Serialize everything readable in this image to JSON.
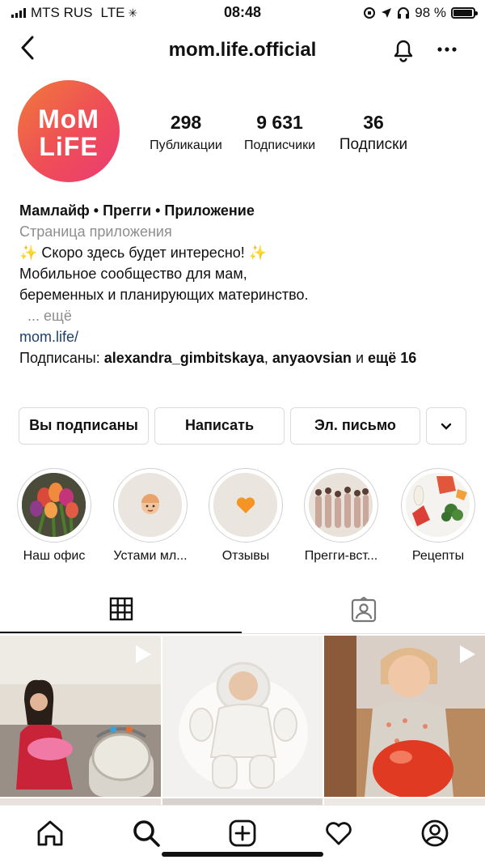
{
  "status_bar": {
    "carrier": "MTS RUS",
    "network": "LTE",
    "time": "08:48",
    "battery": "98 %"
  },
  "header": {
    "title": "mom.life.official",
    "back_icon": "chevron-left-icon",
    "bell_icon": "bell-icon",
    "more_icon": "ellipsis-icon"
  },
  "profile": {
    "logo_line1": "MoM",
    "logo_line2": "LiFE",
    "stats": [
      {
        "value": "298",
        "label": "Публикации"
      },
      {
        "value": "9 631",
        "label": "Подписчики"
      },
      {
        "value": "36",
        "label": "Подписки"
      }
    ]
  },
  "bio": {
    "name": "Мамлайф • Прегги • Приложение",
    "category": "Страница приложения",
    "line1": "✨ Скоро здесь будет интересно! ✨",
    "line2": "Мобильное сообщество для мам,",
    "line3": "беременных и планирующих материнство.",
    "more": "... ещё",
    "link": "mom.life/",
    "followed_prefix": "Подписаны: ",
    "followed_user1": "alexandra_gimbitskaya",
    "followed_sep": ", ",
    "followed_user2": "anyaovsian",
    "followed_and": " и ",
    "followed_more": "ещё 16"
  },
  "actions": {
    "following": "Вы подписаны",
    "message": "Написать",
    "email": "Эл. письмо",
    "dropdown_icon": "chevron-down-icon"
  },
  "highlights": [
    {
      "label": "Наш офис"
    },
    {
      "label": "Устами мл..."
    },
    {
      "label": "Отзывы"
    },
    {
      "label": "Прегги-вст..."
    },
    {
      "label": "Рецепты"
    }
  ],
  "tabs": {
    "grid_icon": "grid-icon",
    "tagged_icon": "tagged-person-icon"
  },
  "bottom_nav": [
    "home-icon",
    "search-icon",
    "new-post-icon",
    "heart-icon",
    "profile-icon"
  ],
  "colors": {
    "brand_gradient_start": "#f07a3a",
    "brand_gradient_end": "#ea3b74",
    "link": "#1d3f6b",
    "muted": "#8e8e8e"
  }
}
